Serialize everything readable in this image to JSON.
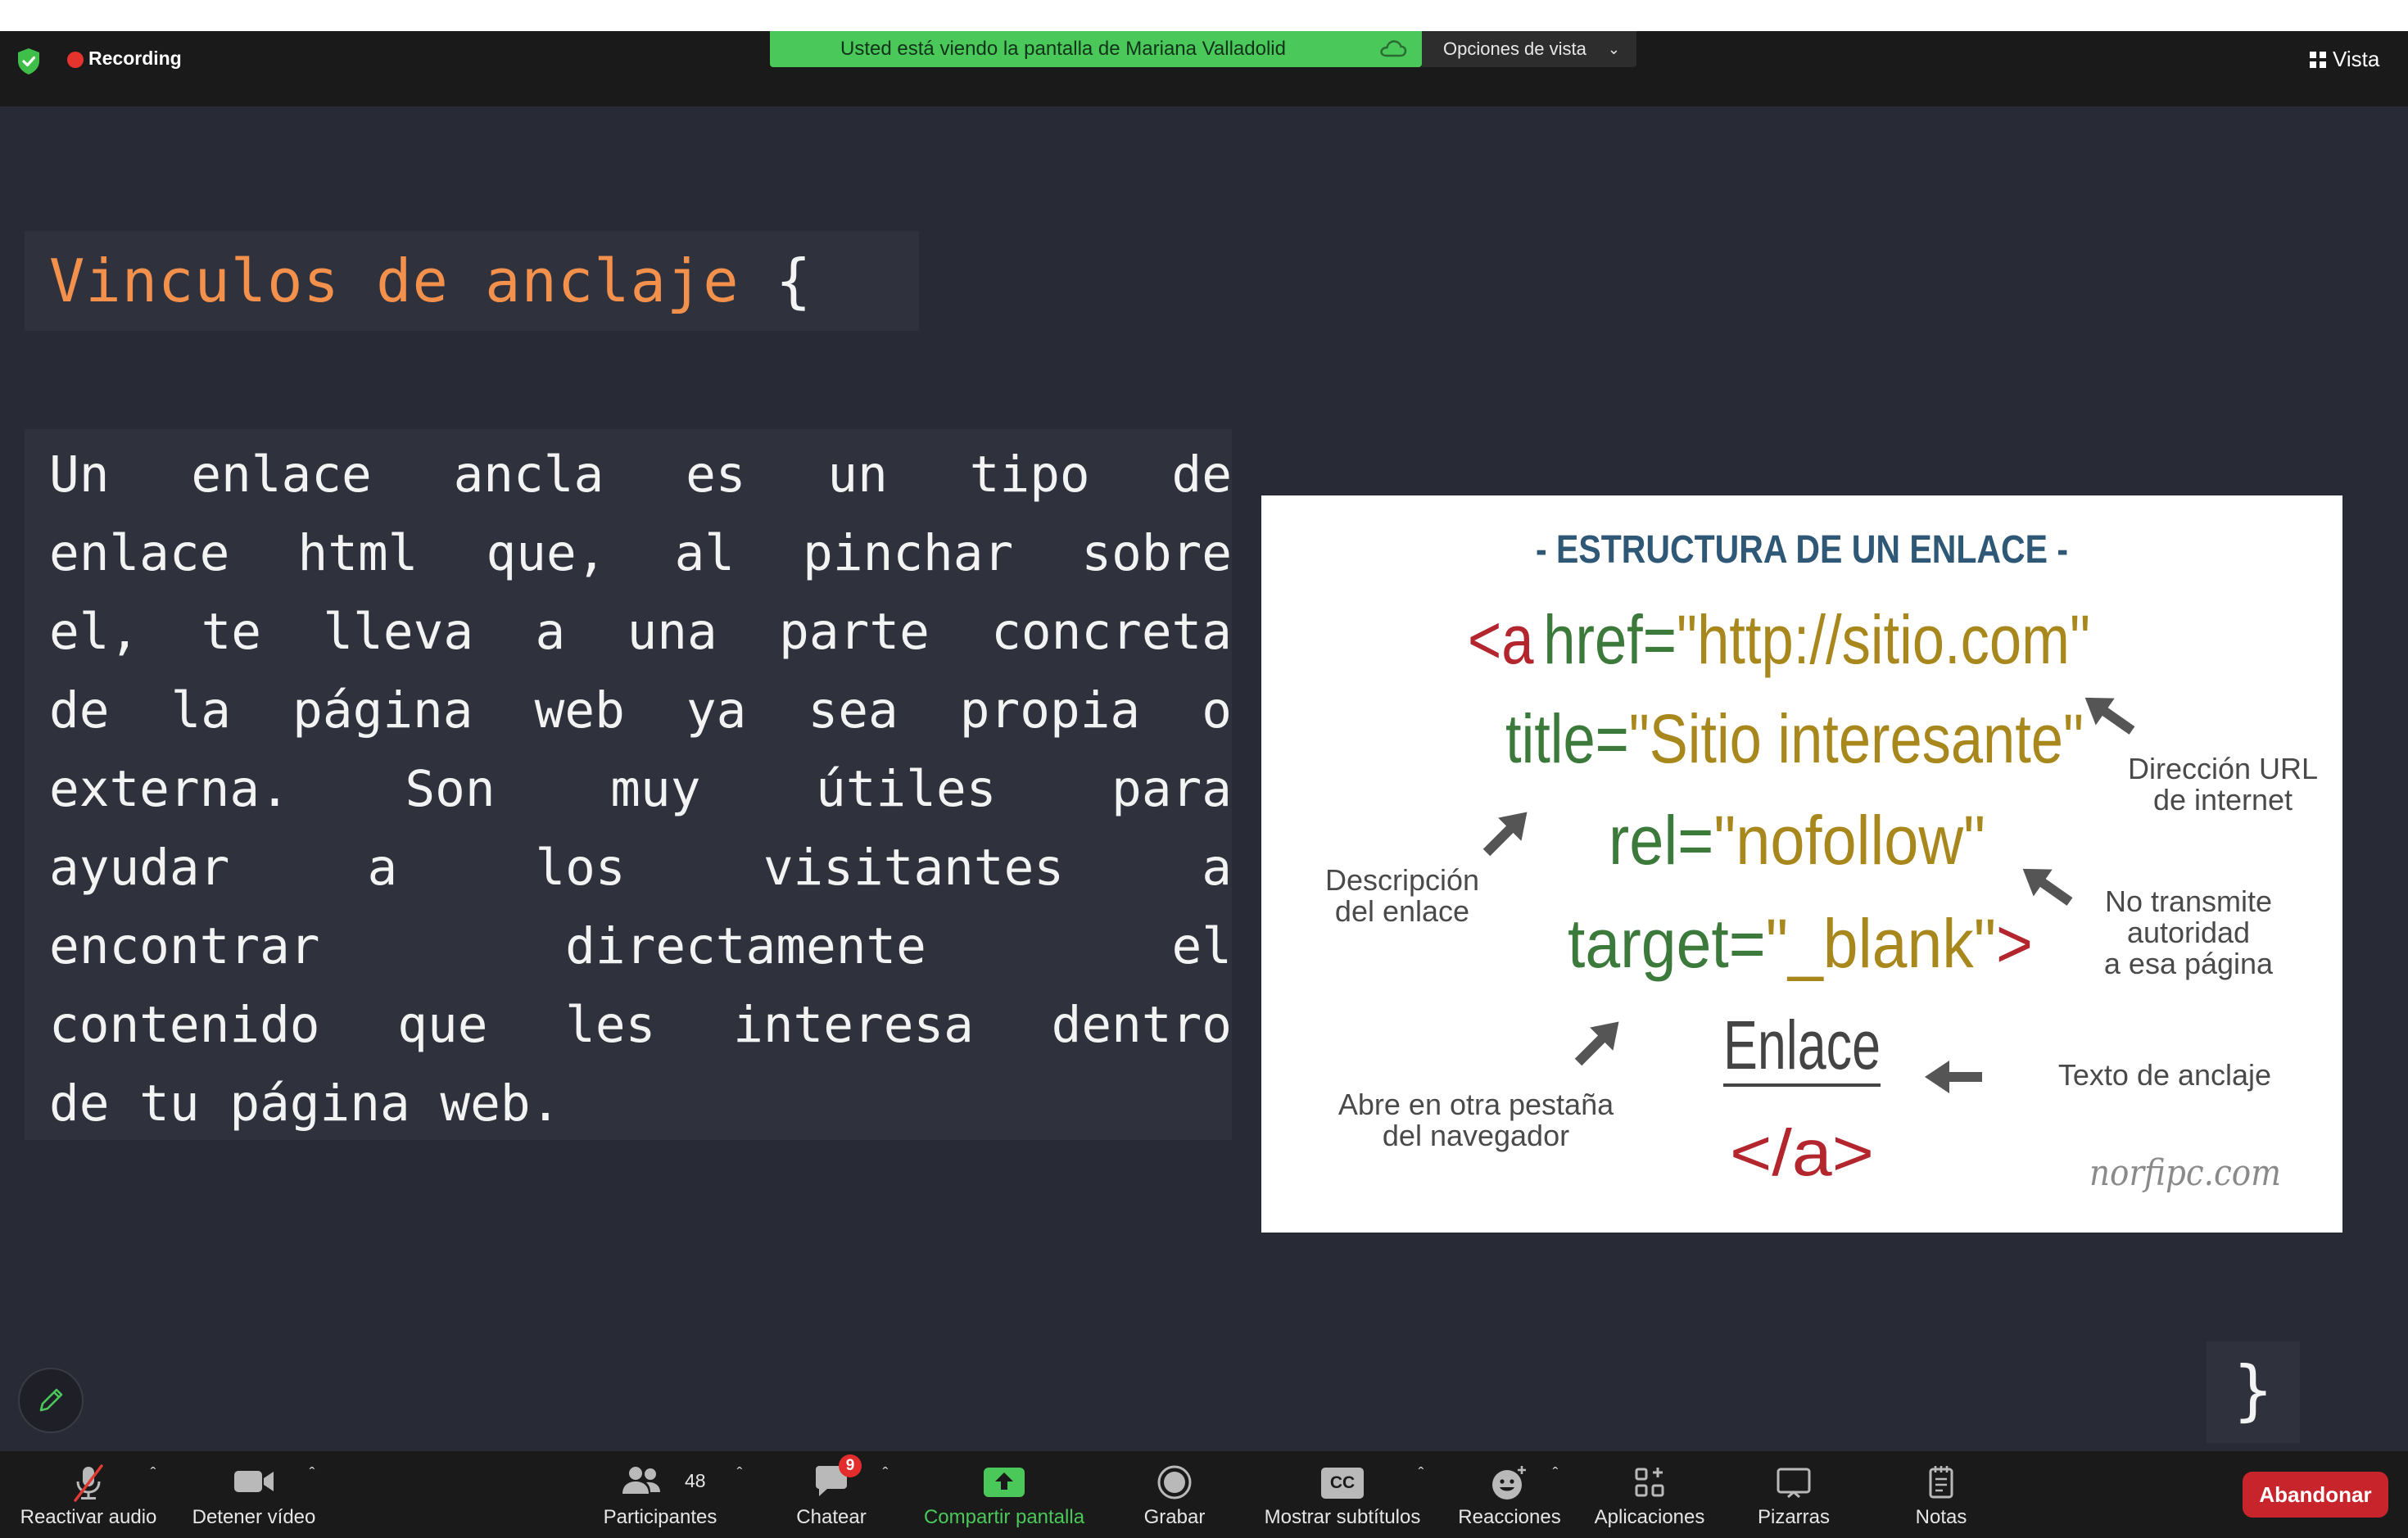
{
  "topbar": {
    "recording_label": "Recording",
    "share_banner": "Usted está viendo la pantalla de Mariana Valladolid",
    "view_options": "Opciones de vista",
    "view_label": "Vista"
  },
  "slide": {
    "title": "Vinculos de anclaje",
    "title_brace": "{",
    "paragraph_lines": [
      "Un enlace ancla es un tipo de",
      "enlace html que, al pinchar sobre",
      "el, te lleva a una parte concreta",
      "de la página web ya sea propia o",
      "externa. Son muy útiles para",
      "ayudar a los visitantes a",
      "encontrar directamente el",
      "contenido que les interesa dentro",
      "de tu página web."
    ],
    "closing_brace": "}",
    "diagram": {
      "heading": "- ESTRUCTURA DE UN ENLACE -",
      "code_open_tag": "<a",
      "code_href_attr": "href=",
      "code_href_value": "\"http://sitio.com\"",
      "code_title_attr": "title=",
      "code_title_value": "\"Sitio interesante\"",
      "code_rel_attr": "rel=",
      "code_rel_value": "\"nofollow\"",
      "code_target_attr": "target=",
      "code_target_value": "\"_blank\"",
      "code_gt": ">",
      "code_link_text": "Enlace",
      "code_close_tag": "</a>",
      "note_url_1": "Dirección URL",
      "note_url_2": "de internet",
      "note_desc_1": "Descripción",
      "note_desc_2": "del enlace",
      "note_rel_1": "No transmite",
      "note_rel_2": "autoridad",
      "note_rel_3": "a esa página",
      "note_target_1": "Abre en otra pestaña",
      "note_target_2": "del navegador",
      "note_anchor": "Texto de anclaje",
      "watermark": "norfipc.com"
    }
  },
  "toolbar": {
    "audio": "Reactivar audio",
    "video": "Detener vídeo",
    "participants": "Participantes",
    "participants_count": "48",
    "chat": "Chatear",
    "chat_badge": "9",
    "share": "Compartir pantalla",
    "record": "Grabar",
    "captions": "Mostrar subtítulos",
    "captions_icon_text": "CC",
    "reactions": "Reacciones",
    "apps": "Aplicaciones",
    "whiteboards": "Pizarras",
    "notes": "Notas",
    "leave": "Abandonar"
  },
  "colors": {
    "banner_green": "#4ac859",
    "title_orange": "#f2904c",
    "code_red": "#b3262d",
    "code_green": "#3c7a3c",
    "code_olive": "#a8871c",
    "heading_blue": "#2f5876",
    "leave_red": "#c8242b"
  },
  "icons": {
    "security": "shield-check-icon",
    "recording": "record-dot-icon",
    "audio": "mic-muted-icon",
    "video": "camera-icon",
    "participants": "people-icon",
    "chat": "chat-bubble-icon",
    "share": "share-arrow-icon",
    "record": "record-circle-icon",
    "captions": "cc-icon",
    "reactions": "smiley-icon",
    "apps": "apps-icon",
    "whiteboards": "whiteboard-icon",
    "notes": "notes-icon",
    "annotate": "pencil-icon"
  }
}
